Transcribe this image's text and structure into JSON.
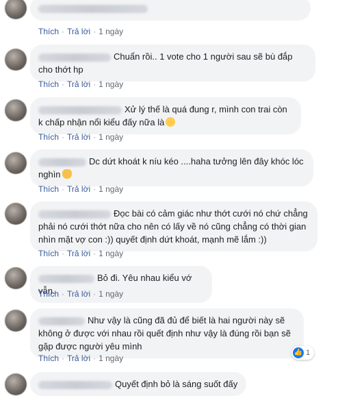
{
  "actions": {
    "like": "Thích",
    "reply": "Trả lời",
    "time": "1 ngày"
  },
  "comments": [
    {
      "text": ""
    },
    {
      "text": "Chuẩn rồi.. 1 vote cho 1 người sau sẽ bù đắp cho thớt hp"
    },
    {
      "text": "Xử lý thế là quá đung r, mình con trai còn k chấp nhận nổi kiểu đấy nữa là",
      "emoji": "hugging-face"
    },
    {
      "text": "Dc dứt khoát k níu kéo ....haha tưởng lên đây khóc lóc nghìn",
      "emoji": "waving-hand"
    },
    {
      "text": "Đọc bài có cảm giác như thớt cưới nó chứ chẳng phải nó cưới thớt nữa cho nên có lấy về nó cũng chẳng có thời gian nhìn mặt vợ con :)) quyết định dứt khoát, mạnh mẽ lắm :))"
    },
    {
      "text": "Bỏ đi. Yêu nhau kiểu vớ vẫn."
    },
    {
      "text": "Như vậy là cũng đã đủ để biết là hai người này sẽ không ở được với nhau rồi quết định như vậy là đúng rồi bạn sẽ gặp được người yêu mình",
      "reactions": "1"
    },
    {
      "text": "Quyết định bỏ là sáng suốt đấy"
    }
  ],
  "colors": {
    "bubble": "#f2f3f5",
    "link": "#385898",
    "like_badge": "#1877f2"
  }
}
